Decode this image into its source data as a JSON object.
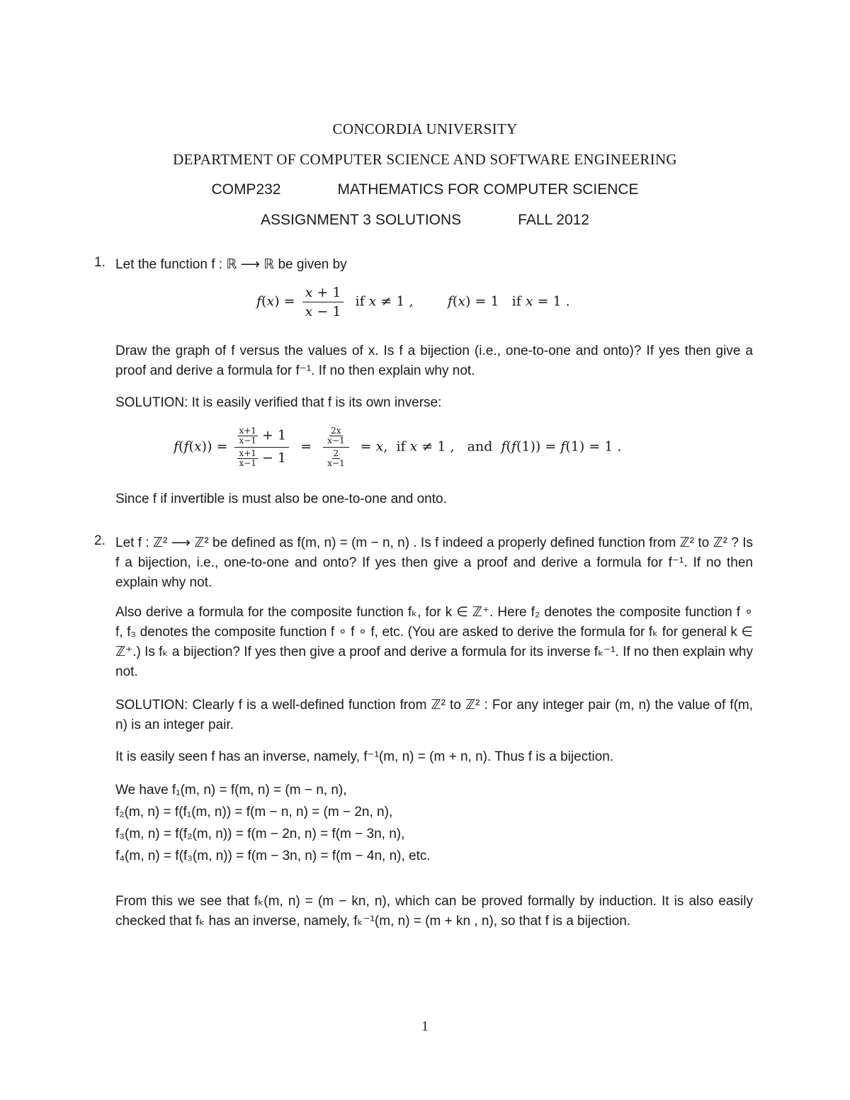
{
  "header": {
    "university": "CONCORDIA UNIVERSITY",
    "department": "DEPARTMENT OF COMPUTER SCIENCE AND SOFTWARE ENGINEERING",
    "course_code": "COMP232",
    "course_name": "MATHEMATICS FOR COMPUTER SCIENCE",
    "assignment": "ASSIGNMENT 3 SOLUTIONS",
    "term": "FALL 2012"
  },
  "problems": [
    {
      "number": "1.",
      "intro": "Let the function f : ℝ ⟶ ℝ be given by",
      "definition": "f(x) = (x + 1)/(x − 1) if x ≠ 1 ,  f(x) = 1 if x = 1 .",
      "question": "Draw the graph of f versus the values of x. Is f a bijection (i.e., one-to-one and onto)? If yes then give a proof and derive a formula for f⁻¹. If no then explain why not.",
      "solution_intro": "SOLUTION: It is easily verified that f is its own inverse:",
      "solution_equation": "f(f(x)) = ((x+1)/(x−1) + 1)/((x+1)/(x−1) − 1) = (2x/(x−1))/(2/(x−1)) = x, if x ≠ 1 , and f(f(1)) = f(1) = 1 .",
      "conclusion": "Since f if invertible is must also be one-to-one and onto."
    },
    {
      "number": "2.",
      "question_1": "Let f : ℤ² ⟶ ℤ² be defined as f(m, n) = (m − n, n) . Is f indeed a properly defined function from ℤ² to ℤ² ? Is f a bijection, i.e., one-to-one and onto? If yes then give a proof and derive a formula for f⁻¹. If no then explain why not.",
      "question_2": "Also derive a formula for the composite function fₖ, for k ∈ ℤ⁺. Here f₂ denotes the composite function f ∘ f, f₃ denotes the composite function f ∘ f ∘ f, etc. (You are asked to derive the formula for fₖ for general k ∈ ℤ⁺.) Is fₖ a bijection? If yes then give a proof and derive a formula for its inverse fₖ⁻¹. If no then explain why not.",
      "solution_1": "SOLUTION: Clearly f is a well-defined function from ℤ² to ℤ² : For any integer pair (m, n) the value of f(m, n) is an integer pair.",
      "solution_2": "It is easily seen f has an inverse, namely, f⁻¹(m, n) = (m + n, n). Thus f is a bijection.",
      "derivation": [
        "We have f₁(m, n) = f(m, n) = (m − n, n),",
        "f₂(m, n) = f(f₁(m, n)) = f(m − n, n) = (m − 2n, n),",
        "f₃(m, n) = f(f₂(m, n)) = f(m − 2n, n) = f(m − 3n, n),",
        "f₄(m, n) = f(f₃(m, n)) = f(m − 3n, n) = f(m − 4n, n), etc."
      ],
      "solution_3": "From this we see that fₖ(m, n) = (m − kn, n), which can be proved formally by induction. It is also easily checked that fₖ has an inverse, namely, fₖ⁻¹(m, n) = (m + kn , n), so that f is a bijection."
    }
  ],
  "footer": {
    "page_number": "1"
  }
}
